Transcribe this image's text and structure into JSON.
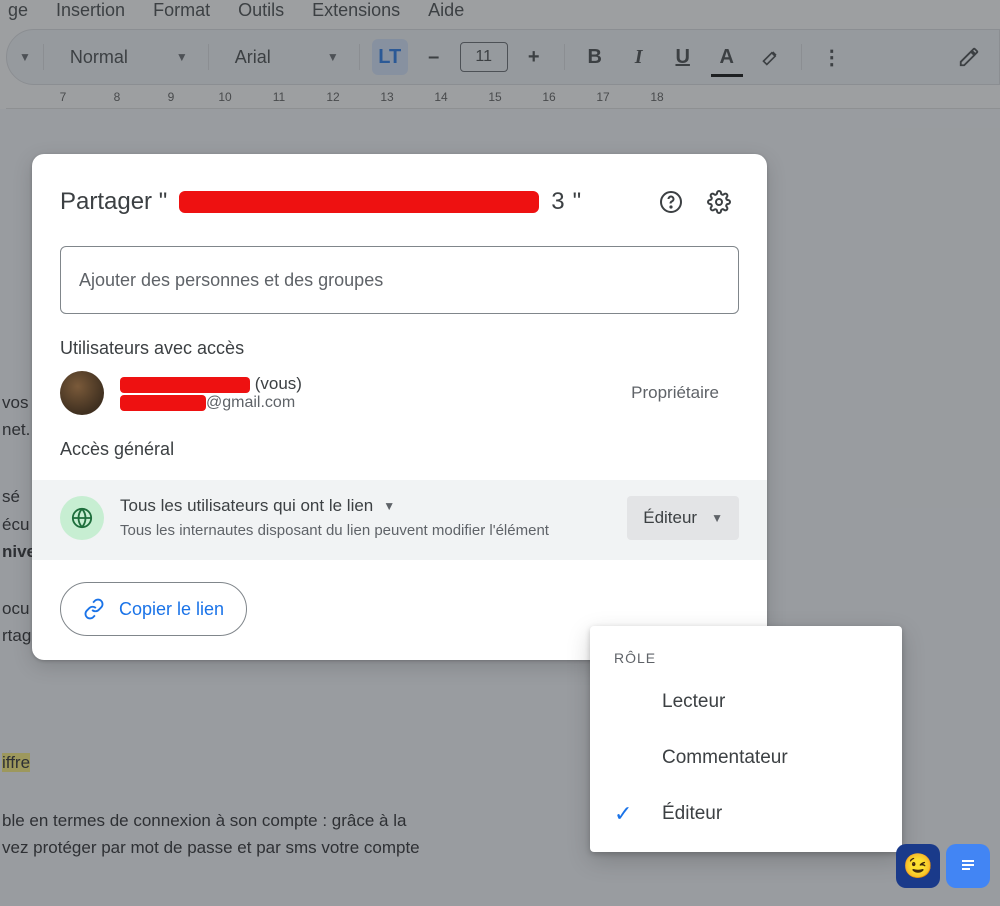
{
  "menus": {
    "m0": "ge",
    "m1": "Insertion",
    "m2": "Format",
    "m3": "Outils",
    "m4": "Extensions",
    "m5": "Aide"
  },
  "toolbar": {
    "style": "Normal",
    "font": "Arial",
    "size": "11",
    "minus": "–",
    "plus": "+",
    "bold": "B",
    "italic": "I",
    "underline": "U",
    "color": "A"
  },
  "ruler": {
    "n0": "7",
    "n1": "8",
    "n2": "9",
    "n3": "10",
    "n4": "11",
    "n5": "12",
    "n6": "13",
    "n7": "14",
    "n8": "15",
    "n9": "16",
    "n10": "17",
    "n11": "18"
  },
  "bg_text": {
    "l1": "vos",
    "l2": "net.",
    "l3": " sé",
    "l4": "écu",
    "l5": "nive",
    "l6": "ocu",
    "l7": "rtag",
    "l8": "iffre",
    "l9": "ble en termes de connexion à son compte : grâce à la",
    "l10": "vez protéger par mot de passe et par sms votre compte"
  },
  "dialog": {
    "title_prefix": "Partager \"",
    "title_suffix_char": "3",
    "title_suffix_quote": "\"",
    "add_placeholder": "Ajouter des personnes et des groupes",
    "users_section": "Utilisateurs avec accès",
    "you_suffix": "(vous)",
    "email_suffix": "@gmail.com",
    "owner": "Propriétaire",
    "general_section": "Accès général",
    "general_title": "Tous les utilisateurs qui ont le lien",
    "general_desc": "Tous les internautes disposant du lien peuvent modifier l'élément",
    "role_selected": "Éditeur",
    "copy_link": "Copier le lien"
  },
  "role_menu": {
    "label": "RÔLE",
    "opt1": "Lecteur",
    "opt2": "Commentateur",
    "opt3": "Éditeur"
  }
}
